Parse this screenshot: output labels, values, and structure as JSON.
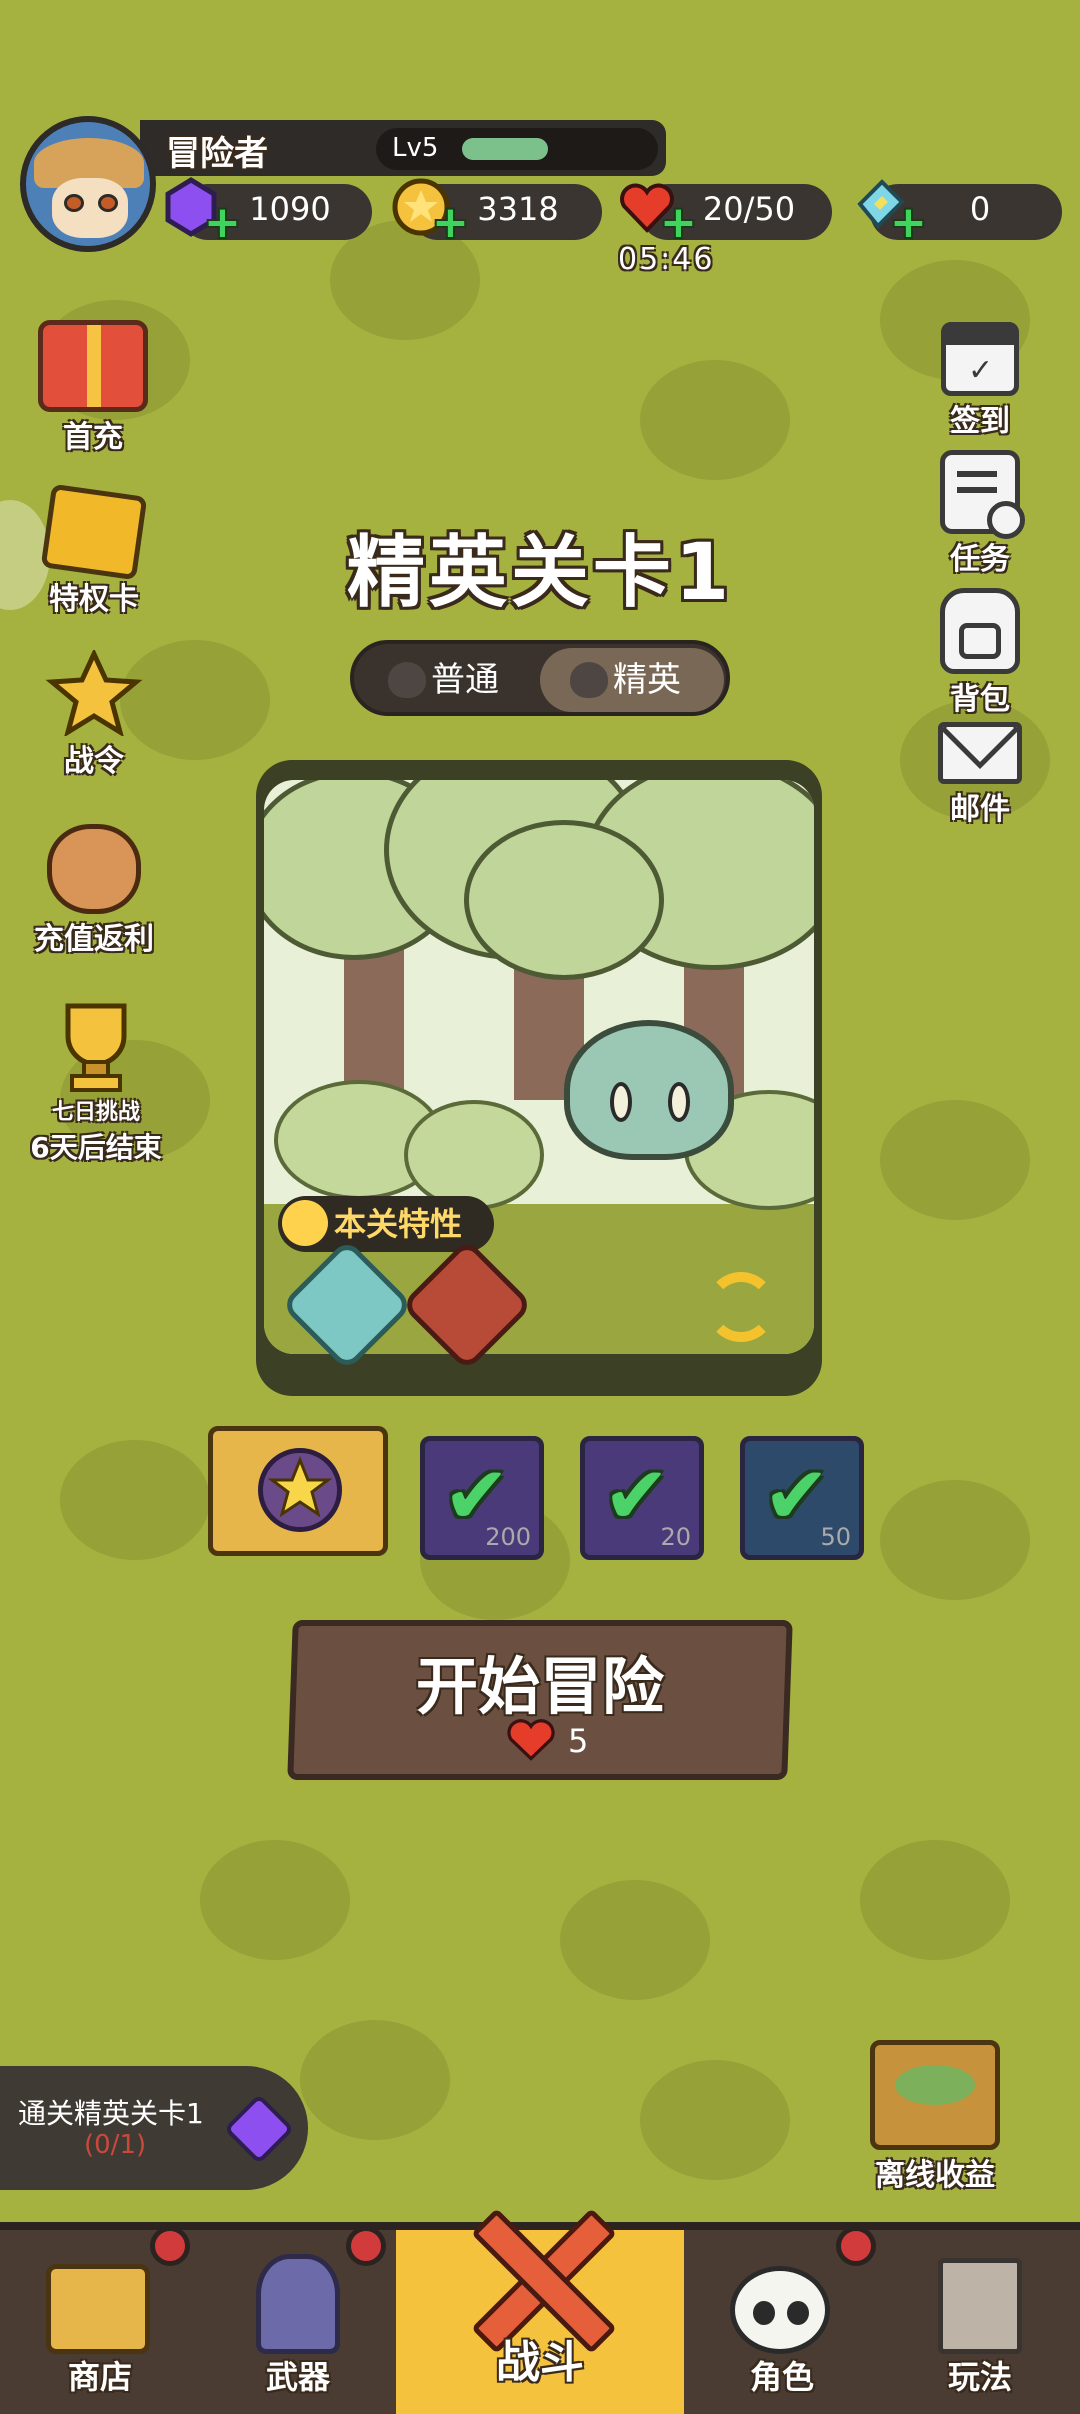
{
  "header": {
    "player_name": "冒险者",
    "level": "Lv5",
    "level_progress": 0.45,
    "gems": "1090",
    "coins": "3318",
    "stamina": "20/50",
    "stamina_timer": "05:46",
    "tickets": "0"
  },
  "left_menu": {
    "first_recharge": "首充",
    "privilege_card": "特权卡",
    "battle_pass": "战令",
    "recharge_rebate": "充值返利",
    "seven_day": "七日挑战",
    "seven_day_end": "6天后结束"
  },
  "right_menu": {
    "checkin": "签到",
    "tasks": "任务",
    "backpack": "背包",
    "mail": "邮件"
  },
  "stage": {
    "title": "精英关卡1",
    "mode_normal": "普通",
    "mode_elite": "精英",
    "features_label": "本关特性"
  },
  "rewards": [
    {
      "qty": "200",
      "colors": {
        "bg": "#4a3a7a"
      }
    },
    {
      "qty": "20",
      "colors": {
        "bg": "#4a3a7a"
      }
    },
    {
      "qty": "50",
      "colors": {
        "bg": "#2d4a6a"
      }
    }
  ],
  "start": {
    "label": "开始冒险",
    "cost": "5"
  },
  "quest": {
    "title": "通关精英关卡1",
    "progress": "(0/1)"
  },
  "offline": {
    "label": "离线收益"
  },
  "nav": {
    "shop": "商店",
    "weapon": "武器",
    "battle": "战斗",
    "character": "角色",
    "gameplay": "玩法"
  },
  "colors": {
    "background": "#a6b240",
    "gold": "#f5c23e",
    "wood": "#6b5041"
  }
}
